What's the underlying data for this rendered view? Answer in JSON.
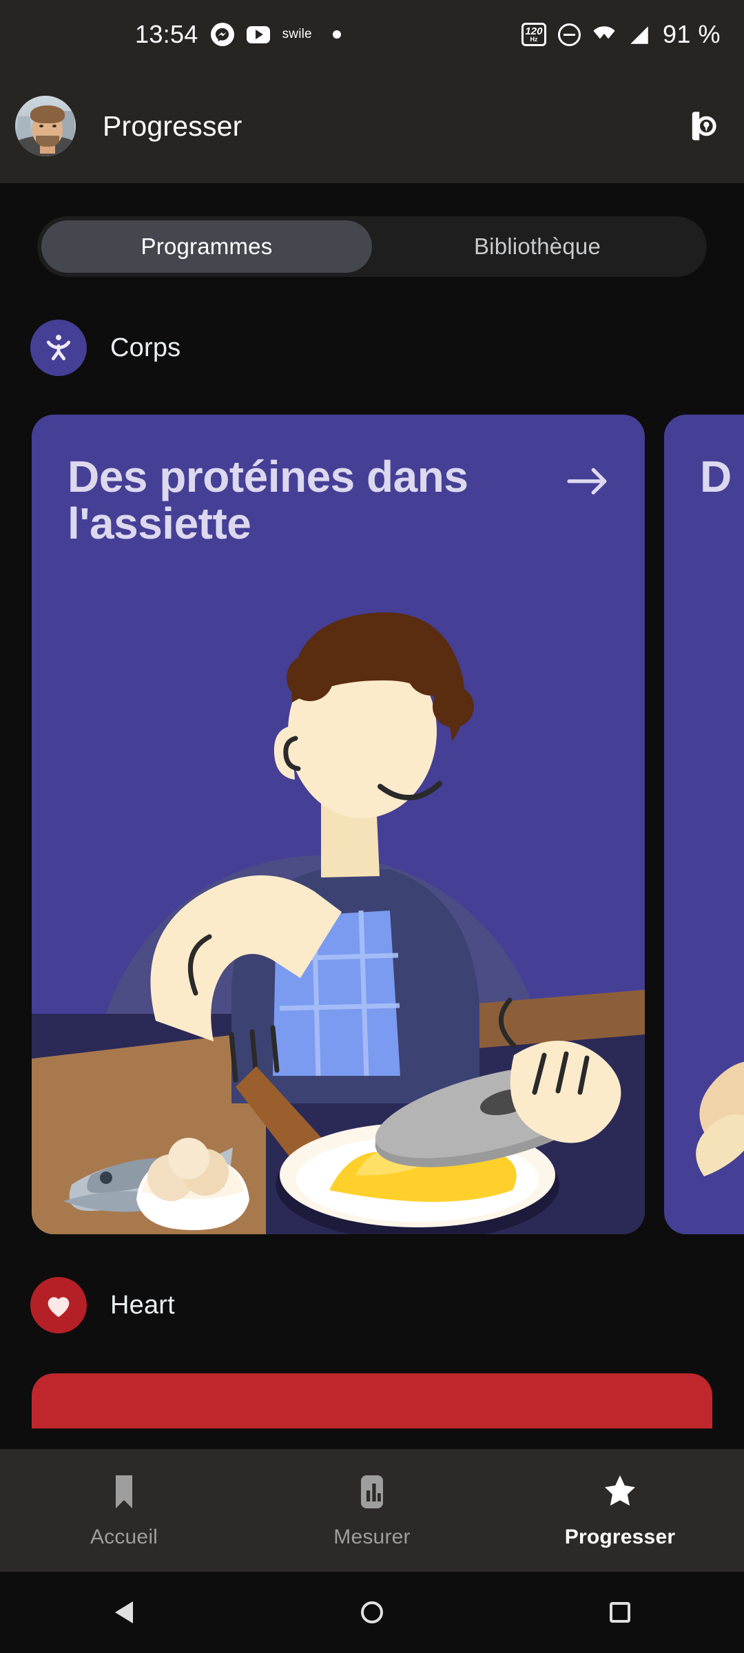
{
  "status_bar": {
    "time": "13:54",
    "swile_label": "swile",
    "battery": "91 %",
    "refresh_rate_value": "120",
    "refresh_rate_unit": "Hz",
    "icons": [
      "messenger-icon",
      "youtube-icon",
      "swile-label",
      "dot-icon",
      "refresh-rate-icon",
      "do-not-disturb-icon",
      "wifi-icon",
      "cellular-signal-icon"
    ]
  },
  "app_bar": {
    "title": "Progresser",
    "avatar_name": "user-avatar",
    "action_icon": "watch-device-icon"
  },
  "tabs": [
    {
      "label": "Programmes",
      "active": true
    },
    {
      "label": "Bibliothèque",
      "active": false
    }
  ],
  "sections": [
    {
      "title": "Corps",
      "icon": "body-person-icon",
      "badge_color": "#453f96",
      "cards": [
        {
          "title": "Des protéines dans l'assiette",
          "arrow": "arrow-right-icon",
          "bg": "#453f96"
        },
        {
          "title": "D p",
          "arrow": "",
          "bg": "#453f96"
        }
      ]
    },
    {
      "title": "Heart",
      "icon": "heart-icon",
      "badge_color": "#b42026",
      "cards": [
        {
          "title": "",
          "arrow": "",
          "bg": "#c0272d"
        }
      ]
    }
  ],
  "bottom_nav": [
    {
      "label": "Accueil",
      "icon": "bookmark-icon",
      "active": false
    },
    {
      "label": "Mesurer",
      "icon": "bar-chart-icon",
      "active": false
    },
    {
      "label": "Progresser",
      "icon": "star-icon",
      "active": true
    }
  ],
  "system_nav": [
    {
      "name": "back-button",
      "icon": "triangle-back-icon"
    },
    {
      "name": "home-button",
      "icon": "circle-home-icon"
    },
    {
      "name": "recents-button",
      "icon": "square-recents-icon"
    }
  ],
  "colors": {
    "background": "#0d0d0d",
    "surface": "#262522",
    "accent_purple": "#453f96",
    "accent_red": "#c0272d",
    "tab_active": "#44474e"
  }
}
